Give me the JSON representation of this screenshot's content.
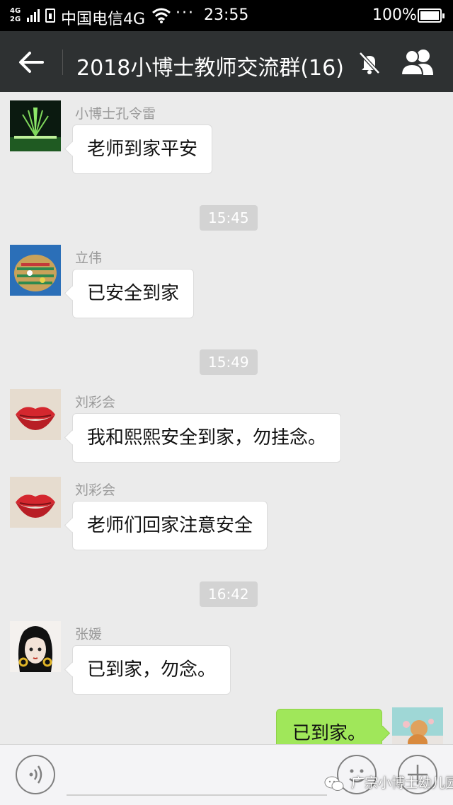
{
  "status_bar": {
    "network_top": "4G",
    "network_bottom": "2G",
    "carrier": "中国电信4G",
    "more": "···",
    "time": "23:55",
    "battery": "100%"
  },
  "nav": {
    "title": "2018小博士教师交流群(16)",
    "back_icon": "arrow-left-icon",
    "mute_icon": "bell-muted-icon",
    "members_icon": "people-icon"
  },
  "messages": [
    {
      "sender": "小博士孔令雷",
      "text": "老师到家平安"
    },
    {
      "timestamp": "15:45"
    },
    {
      "sender": "立伟",
      "text": "已安全到家"
    },
    {
      "timestamp": "15:49"
    },
    {
      "sender": "刘彩会",
      "text": "我和熙熙安全到家，勿挂念。"
    },
    {
      "sender": "刘彩会",
      "text": "老师们回家注意安全"
    },
    {
      "timestamp": "16:42"
    },
    {
      "sender": "张媛",
      "text": "已到家，勿念。"
    },
    {
      "text": "已到家。",
      "self": true
    }
  ],
  "input_bar": {
    "voice_icon": "voice-icon",
    "emoji_icon": "emoji-icon",
    "plus_icon": "plus-icon"
  },
  "watermark": "广宗小博士幼儿园",
  "colors": {
    "nav_bg": "#2e3132",
    "chat_bg": "#ebebeb",
    "self_bubble": "#a0e75a",
    "timestamp_bg": "#d3d3d3"
  }
}
